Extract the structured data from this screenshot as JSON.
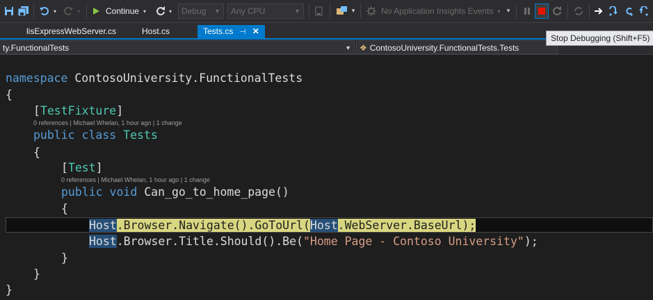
{
  "toolbar": {
    "continue_label": "Continue",
    "config_value": "Debug",
    "platform_value": "Any CPU",
    "insights_label": "No Application Insights Events"
  },
  "tabs": [
    {
      "label": "lisExpressWebServer.cs"
    },
    {
      "label": "Host.cs"
    },
    {
      "label": "Tests.cs",
      "active": true,
      "pin": "⊣",
      "close": "✕"
    }
  ],
  "navbar": {
    "left": "ty.FunctionalTests",
    "right": "ContosoUniversity.FunctionalTests.Tests"
  },
  "tooltip": "Stop Debugging (Shift+F5)",
  "code": {
    "l1_kw": "namespace",
    "l1_rest": " ContosoUniversity.FunctionalTests",
    "brace_open": "{",
    "brace_close": "}",
    "attr_fixture_open": "[",
    "attr_fixture_name": "TestFixture",
    "attr_fixture_close": "]",
    "lens_class": "0 references | Michael Whelan, 1 hour ago | 1 change",
    "class_kw1": "public",
    "class_kw2": "class",
    "class_name": "Tests",
    "attr_test_open": "[",
    "attr_test_name": "Test",
    "attr_test_close": "]",
    "lens_method": "0 references | Michael Whelan, 1 hour ago | 1 change",
    "method_kw1": "public",
    "method_kw2": "void",
    "method_rest": " Can_go_to_home_page()",
    "stmt1_host1": "Host",
    "stmt1_mid": ".Browser.Navigate().GoToUrl(",
    "stmt1_host2": "Host",
    "stmt1_end": ".WebServer.BaseUrl);",
    "stmt2_host": "Host",
    "stmt2_mid": ".Browser.Title.Should().Be(",
    "stmt2_str": "\"Home Page - Contoso University\"",
    "stmt2_end": ");"
  },
  "colors": {
    "accent": "#007acc",
    "keyword": "#569cd6",
    "type": "#4ec9b0",
    "string": "#d69d85",
    "current_statement": "#d8d781",
    "reference_highlight": "#264f78",
    "stop_button": "#e51400"
  },
  "icons": [
    "save-icon",
    "save-all-icon",
    "undo-icon",
    "redo-icon",
    "play-icon",
    "restart-icon",
    "attach-icon",
    "explorer-icon",
    "insights-icon",
    "pause-icon",
    "stop-icon",
    "refresh-icon",
    "show-next-icon",
    "step-into-icon",
    "step-over-icon",
    "step-out-icon"
  ]
}
